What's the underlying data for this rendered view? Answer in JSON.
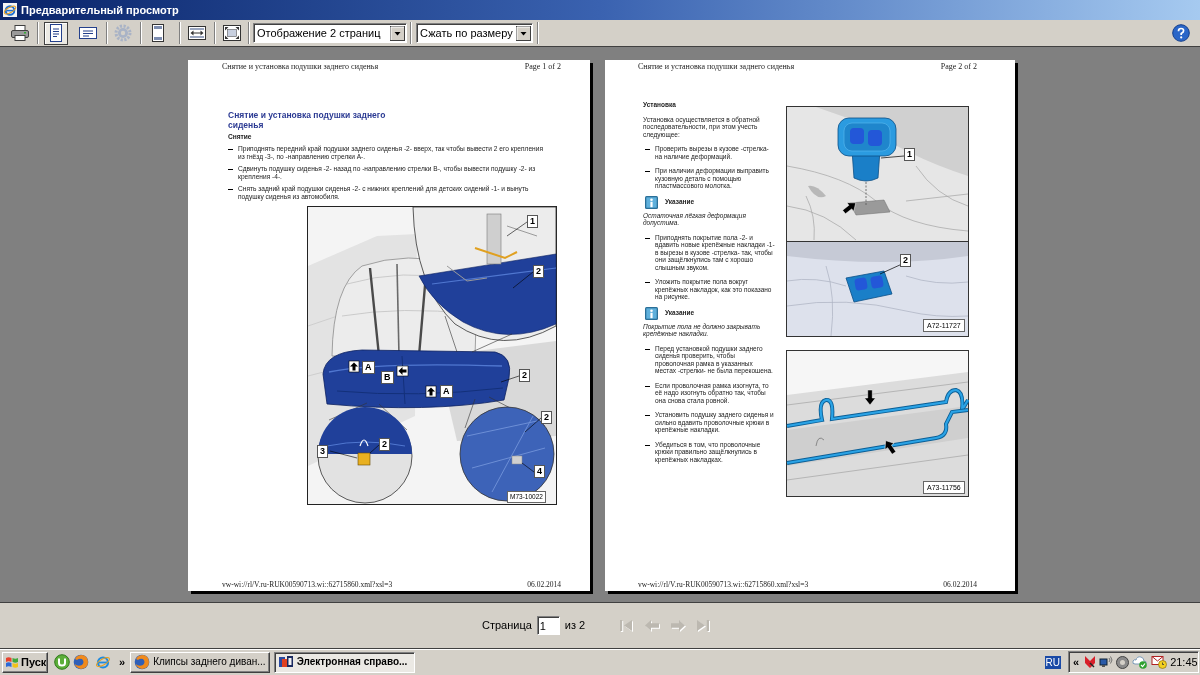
{
  "window": {
    "title": "Предварительный просмотр"
  },
  "toolbar": {
    "buttons": [
      {
        "selected": false,
        "disabled": false
      },
      {
        "selected": true,
        "disabled": false
      },
      {
        "selected": false,
        "disabled": false
      },
      {
        "selected": false,
        "disabled": true
      },
      {
        "selected": false,
        "disabled": false
      },
      {
        "selected": false,
        "disabled": false
      },
      {
        "selected": false,
        "disabled": false
      }
    ],
    "dropdowns": [
      {
        "value": "Отображение 2 страниц"
      },
      {
        "value": "Сжать по размеру"
      }
    ]
  },
  "pages": [
    {
      "kind": "stacked",
      "header": {
        "title": "Снятие и установка подушки заднего сиденья",
        "page": "Page 1 of 2"
      },
      "blocks": [
        {
          "kind": "title",
          "text": "Снятие и установка подушки заднего сиденья"
        },
        {
          "kind": "heading",
          "text": "Снятие"
        },
        {
          "kind": "bullet",
          "text": "Приподнять передний край подушки заднего сиденья -2- вверх, так чтобы вывести 2 его крепления из гнёзд -3-, по -направлению стрелки A-."
        },
        {
          "kind": "bullet",
          "text": "Сдвинуть подушку сиденья -2- назад по -направлению стрелки B-, чтобы вывести подушку -2- из крепления -4-."
        },
        {
          "kind": "bullet",
          "text": "Снять задний край подушки сиденья -2- с нижних креплений для детских сидений -1- и вынуть подушку сиденья из автомобиля."
        }
      ],
      "figures": [
        {
          "kind": "seat",
          "callouts": [
            "1",
            "2",
            "A",
            "B",
            "A",
            "2",
            "2",
            "3",
            "2",
            "4"
          ],
          "code": "M73-10022"
        }
      ],
      "footer": {
        "url": "vw-wi://rl/V.ru-RUK00590713.wi::62715860.xml?xsl=3",
        "date": "06.02.2014"
      }
    },
    {
      "kind": "columns",
      "header": {
        "title": "Снятие и установка подушки заднего сиденья",
        "page": "Page 2 of 2"
      },
      "blocks": [
        {
          "kind": "heading",
          "text": "Установка"
        },
        {
          "kind": "paragraph",
          "text": "Установка осуществляется в обратной последовательности, при этом учесть следующее:"
        },
        {
          "kind": "bullet",
          "text": "Проверить вырезы в кузове -стрелка- на наличие деформаций."
        },
        {
          "kind": "bullet",
          "text": "При наличии деформации выправить кузовную деталь с помощью пластмассового молотка."
        },
        {
          "kind": "note",
          "text": "Указание"
        },
        {
          "kind": "note_text",
          "text": "Остаточная лёгкая деформация допустима."
        },
        {
          "kind": "bullet",
          "text": "Приподнять покрытие пола -2- и вдавить новые крепёжные накладки -1- в вырезы в кузове -стрелка- так, чтобы они защёлкнулись там с хорошо слышным звуком."
        },
        {
          "kind": "bullet",
          "text": "Уложить покрытие пола вокруг крепёжных накладок, как это показано на рисунке."
        },
        {
          "kind": "note",
          "text": "Указание"
        },
        {
          "kind": "note_text",
          "text": "Покрытие пола не должно закрывать крепёжные накладки."
        },
        {
          "kind": "bullet",
          "text": "Перед установкой подушки заднего сиденья проверить, чтобы проволочная рамка в указанных местах -стрелки- не была перекошена."
        },
        {
          "kind": "bullet",
          "text": "Если проволочная рамка изогнута, то её надо изогнуть обратно так, чтобы она снова стала ровной."
        },
        {
          "kind": "bullet",
          "text": "Установить подушку заднего сиденья и сильно вдавить проволочные крюки в крепёжные накладки."
        },
        {
          "kind": "bullet",
          "text": "Убедиться в том, что проволочные крюки правильно защёлкнулись в крепёжных накладках."
        }
      ],
      "figures": [
        {
          "kind": "clip",
          "callouts": [
            "1",
            "2"
          ],
          "code": "A72-11727"
        },
        {
          "kind": "wire",
          "code": "A73-11756"
        }
      ],
      "footer": {
        "url": "vw-wi://rl/V.ru-RUK00590713.wi::62715860.xml?xsl=3",
        "date": "06.02.2014"
      }
    }
  ],
  "navigation": {
    "label": "Страница",
    "value": "1",
    "total": "из 2",
    "buttons": [
      {
        "disabled": true
      },
      {
        "disabled": true
      },
      {
        "disabled": true
      },
      {
        "disabled": true
      }
    ]
  },
  "taskbar": {
    "start": "Пуск",
    "more": "»",
    "tasks": [
      {
        "label": "Клипсы заднего диван...",
        "selected": false
      },
      {
        "label": "Электронная справо...",
        "selected": true
      }
    ],
    "language": "RU",
    "tray_expand": "«",
    "clock": "21:45"
  }
}
